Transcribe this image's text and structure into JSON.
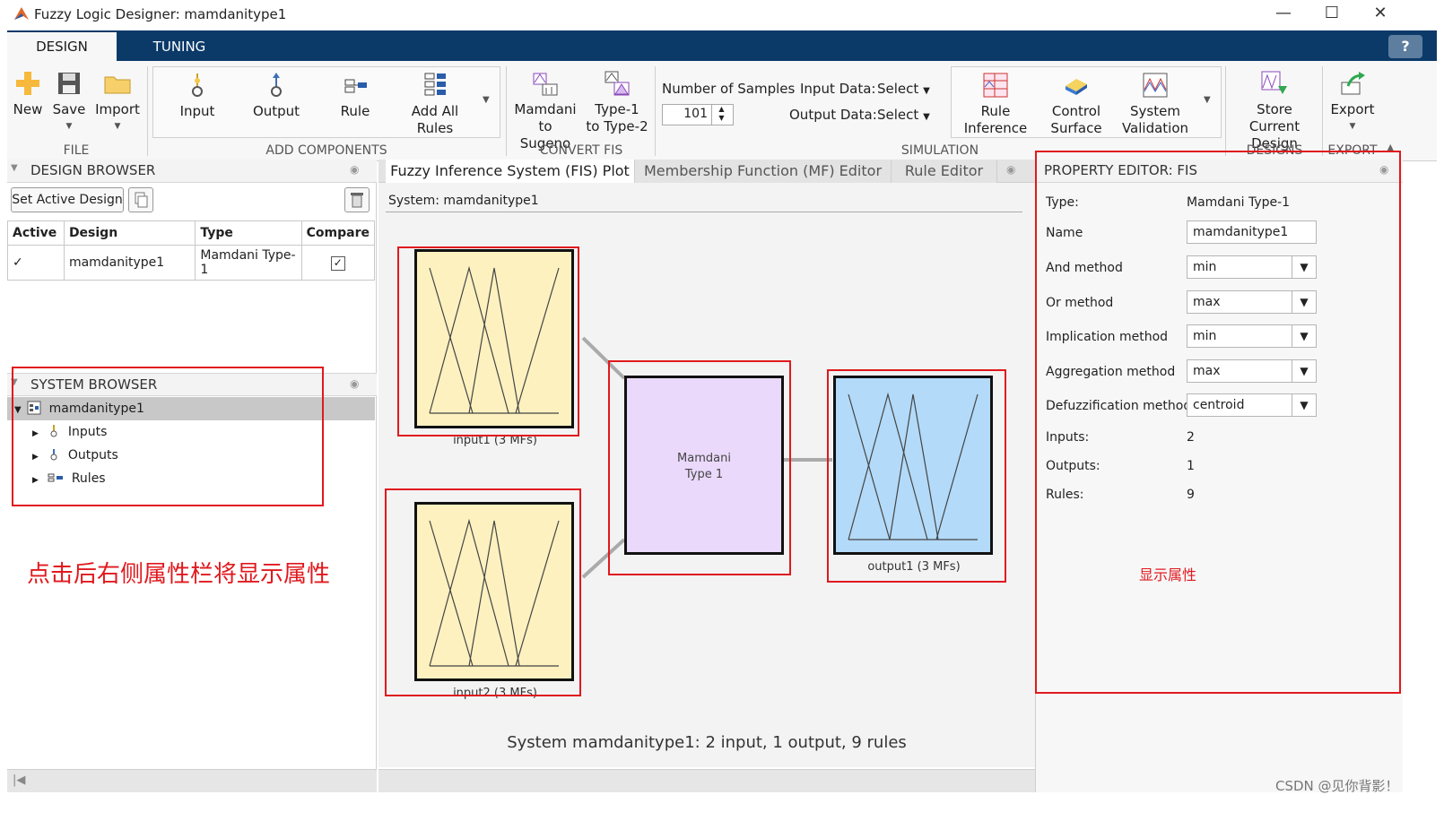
{
  "window": {
    "title": "Fuzzy Logic Designer: mamdanitype1",
    "minimize": "—",
    "maximize": "☐",
    "close": "✕"
  },
  "tabs": {
    "design": "DESIGN",
    "tuning": "TUNING",
    "help": "?"
  },
  "ribbon": {
    "file": {
      "label": "FILE",
      "new": "New",
      "save": "Save",
      "import": "Import"
    },
    "add_components": {
      "label": "ADD COMPONENTS",
      "input": "Input",
      "output": "Output",
      "rule": "Rule",
      "add_all_1": "Add All",
      "add_all_2": "Rules"
    },
    "convert_fis": {
      "label": "CONVERT FIS",
      "mamdani_1": "Mamdani",
      "mamdani_2": "to Sugeno",
      "type1_1": "Type-1",
      "type1_2": "to Type-2"
    },
    "simulation": {
      "label": "SIMULATION",
      "num_samples_label": "Number of Samples",
      "num_samples_value": "101",
      "input_data_label": "Input Data:",
      "input_data_value": "Select",
      "output_data_label": "Output Data:",
      "output_data_value": "Select",
      "rule_inf_1": "Rule",
      "rule_inf_2": "Inference",
      "ctrl_surf_1": "Control",
      "ctrl_surf_2": "Surface",
      "sys_val_1": "System",
      "sys_val_2": "Validation"
    },
    "designs": {
      "label": "DESIGNS",
      "store_1": "Store Current",
      "store_2": "Design"
    },
    "export": {
      "label": "EXPORT",
      "export": "Export"
    }
  },
  "design_browser": {
    "title": "DESIGN BROWSER",
    "set_active": "Set Active Design",
    "columns": [
      "Active",
      "Design",
      "Type",
      "Compare"
    ],
    "rows": [
      {
        "active": "✓",
        "design": "mamdanitype1",
        "type": "Mamdani Type-1",
        "compare": "✓"
      }
    ]
  },
  "system_browser": {
    "title": "SYSTEM BROWSER",
    "root": "mamdanitype1",
    "items": [
      "Inputs",
      "Outputs",
      "Rules"
    ]
  },
  "annotation_left": "点击后右侧属性栏将显示属性",
  "doc_tabs": [
    "Fuzzy Inference System (FIS) Plot",
    "Membership Function (MF) Editor",
    "Rule Editor"
  ],
  "fis_plot": {
    "system_label": "System: mamdanitype1",
    "input1": "input1 (3 MFs)",
    "input2": "input2 (3 MFs)",
    "engine_1": "Mamdani",
    "engine_2": "Type 1",
    "output1": "output1 (3 MFs)",
    "summary": "System mamdanitype1: 2 input, 1 output, 9 rules",
    "input_color": "#fdf1c0",
    "engine_color": "#ead9fb",
    "output_color": "#b3daf8"
  },
  "property_editor": {
    "title": "PROPERTY EDITOR: FIS",
    "type_label": "Type:",
    "type_value": "Mamdani Type-1",
    "name_label": "Name",
    "name_value": "mamdanitype1",
    "and_label": "And method",
    "and_value": "min",
    "or_label": "Or method",
    "or_value": "max",
    "impl_label": "Implication method",
    "impl_value": "min",
    "agg_label": "Aggregation method",
    "agg_value": "max",
    "defuzz_label": "Defuzzification method",
    "defuzz_value": "centroid",
    "inputs_label": "Inputs:",
    "inputs_value": "2",
    "outputs_label": "Outputs:",
    "outputs_value": "1",
    "rules_label": "Rules:",
    "rules_value": "9"
  },
  "annotation_right": "显示属性",
  "watermark": "CSDN @见你背影！",
  "accent": "#0b3a69",
  "annotation_color": "#e0191e"
}
